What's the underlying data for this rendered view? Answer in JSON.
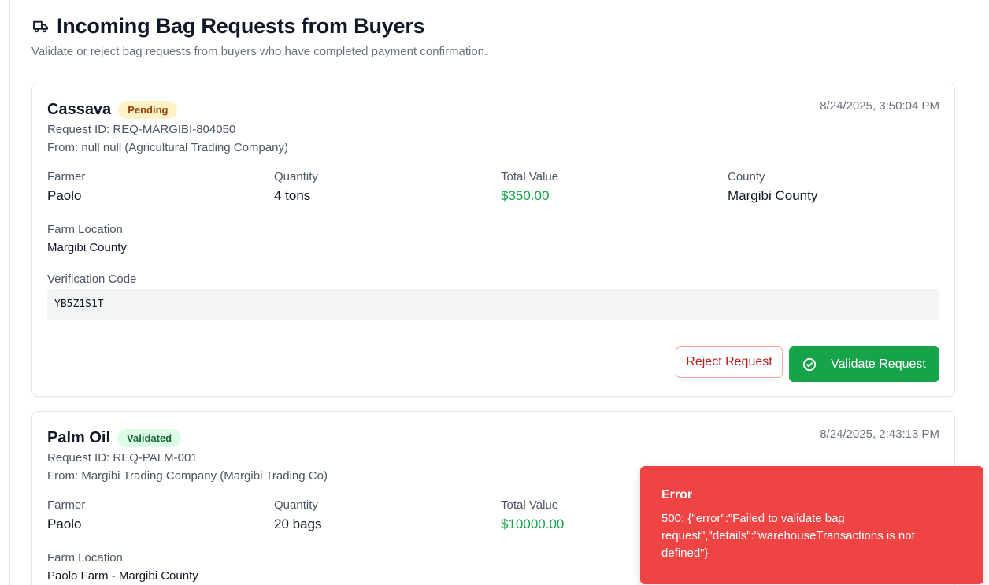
{
  "header": {
    "title": "Incoming Bag Requests from Buyers",
    "subtitle": "Validate or reject bag requests from buyers who have completed payment confirmation.",
    "icon": "truck-icon"
  },
  "requests": [
    {
      "crop": "Cassava",
      "status": "Pending",
      "timestamp": "8/24/2025, 3:50:04 PM",
      "request_id": "Request ID: REQ-MARGIBI-804050",
      "from": "From: null null (Agricultural Trading Company)",
      "labels": {
        "farmer": "Farmer",
        "quantity": "Quantity",
        "total_value": "Total Value",
        "county": "County",
        "farm_location": "Farm Location",
        "verification_code": "Verification Code"
      },
      "farmer": "Paolo",
      "quantity": "4 tons",
      "total_value": "$350.00",
      "county": "Margibi County",
      "farm_location": "Margibi County",
      "verification_code": "YB5Z1S1T",
      "actions": {
        "reject": "Reject Request",
        "validate": "Validate Request"
      }
    },
    {
      "crop": "Palm Oil",
      "status": "Validated",
      "timestamp": "8/24/2025, 2:43:13 PM",
      "request_id": "Request ID: REQ-PALM-001",
      "from": "From: Margibi Trading Company (Margibi Trading Co)",
      "labels": {
        "farmer": "Farmer",
        "quantity": "Quantity",
        "total_value": "Total Value",
        "farm_location": "Farm Location"
      },
      "farmer": "Paolo",
      "quantity": "20 bags",
      "total_value": "$10000.00",
      "farm_location": "Paolo Farm - Margibi County"
    }
  ],
  "toast": {
    "title": "Error",
    "message": "500: {\"error\":\"Failed to validate bag request\",\"details\":\"warehouseTransactions is not defined\"}"
  },
  "colors": {
    "accent_green": "#16a34a",
    "error_red": "#ef4444",
    "pending_badge": "#fef3c7",
    "validated_badge": "#dcfce7"
  }
}
